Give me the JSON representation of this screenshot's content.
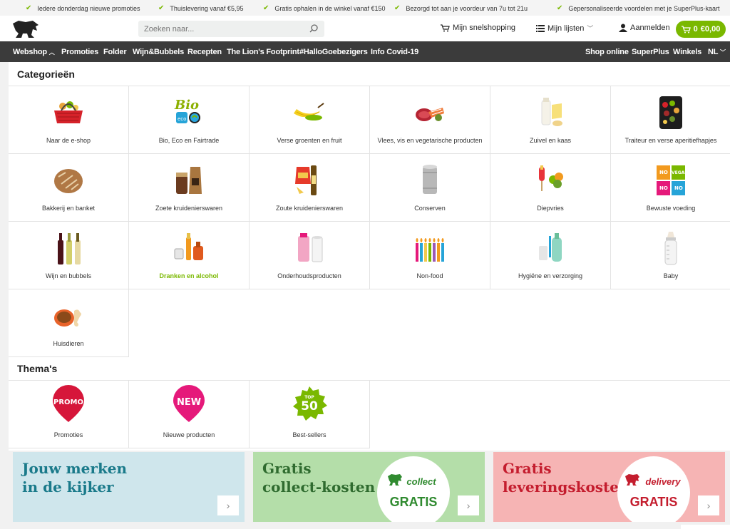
{
  "promo_strip": [
    "Iedere donderdag nieuwe promoties",
    "Thuislevering vanaf €5,95",
    "Gratis ophalen in de winkel vanaf €150",
    "Bezorgd tot aan je voordeur van 7u tot 21u",
    "Gepersonaliseerde voordelen met je SuperPlus-kaart"
  ],
  "header": {
    "search_placeholder": "Zoeken naar...",
    "quick_shopping": "Mijn snelshopping",
    "my_lists": "Mijn lijsten",
    "login": "Aanmelden",
    "cart_count": "0",
    "cart_total": "€0,00"
  },
  "nav": {
    "left": [
      "Webshop",
      "Promoties",
      "Folder",
      "Wijn&Bubbels",
      "Recepten",
      "The Lion's Footprint",
      "#HalloGoebezigers",
      "Info Covid-19"
    ],
    "right": [
      "Shop online",
      "SuperPlus",
      "Winkels",
      "NL"
    ]
  },
  "categories_title": "Categorieën",
  "categories": [
    {
      "label": "Naar de e-shop",
      "icon": "basket-icon"
    },
    {
      "label": "Bio, Eco en Fairtrade",
      "icon": "bio-eco-icon",
      "bio_text": "Bio",
      "eco_text": "eco"
    },
    {
      "label": "Verse groenten en fruit",
      "icon": "banana-icon"
    },
    {
      "label": "Vlees, vis en vegetarische producten",
      "icon": "meat-icon"
    },
    {
      "label": "Zuivel en kaas",
      "icon": "dairy-icon"
    },
    {
      "label": "Traiteur en verse aperitiefhapjes",
      "icon": "traiteur-icon"
    },
    {
      "label": "Bakkerij en banket",
      "icon": "bread-icon"
    },
    {
      "label": "Zoete kruidenierswaren",
      "icon": "sweet-grocery-icon"
    },
    {
      "label": "Zoute kruidenierswaren",
      "icon": "salty-grocery-icon"
    },
    {
      "label": "Conserven",
      "icon": "can-icon"
    },
    {
      "label": "Diepvries",
      "icon": "frozen-icon"
    },
    {
      "label": "Bewuste voeding",
      "icon": "conscious-food-icon",
      "tiles": [
        "NO",
        "VEGAN",
        "NO",
        "NO"
      ]
    },
    {
      "label": "Wijn en bubbels",
      "icon": "wine-icon"
    },
    {
      "label": "Dranken en alcohol",
      "icon": "drinks-icon",
      "highlight": true
    },
    {
      "label": "Onderhoudsproducten",
      "icon": "cleaning-icon"
    },
    {
      "label": "Non-food",
      "icon": "candles-icon"
    },
    {
      "label": "Hygiëne en verzorging",
      "icon": "hygiene-icon"
    },
    {
      "label": "Baby",
      "icon": "baby-bottle-icon"
    },
    {
      "label": "Huisdieren",
      "icon": "pet-icon"
    }
  ],
  "themes_title": "Thema's",
  "themes": [
    {
      "label": "Promoties",
      "badge": "PROMO",
      "icon": "promo-badge-icon"
    },
    {
      "label": "Nieuwe producten",
      "badge": "NEW",
      "icon": "new-badge-icon"
    },
    {
      "label": "Best-sellers",
      "badge_top": "TOP",
      "badge": "50",
      "icon": "top50-badge-icon"
    }
  ],
  "banners": [
    {
      "line1": "Jouw merken",
      "line2": "in de kijker",
      "bg": "#cfe6ec",
      "color": "#1a7a8a"
    },
    {
      "line1": "Gratis",
      "line2": "collect-kosten",
      "bg": "#b4dea9",
      "color": "#2f6b2f",
      "circle_top": "collect",
      "circle_bottom": "GRATIS"
    },
    {
      "line1": "Gratis",
      "line2": "leveringskosten",
      "bg": "#f6b4b4",
      "color": "#c41d2e",
      "circle_top": "delivery",
      "circle_bottom": "GRATIS"
    }
  ],
  "colors": {
    "accent": "#7ab800",
    "nav_bg": "#3b3b3b",
    "promo_red": "#d6163a",
    "new_pink": "#e5197a"
  }
}
